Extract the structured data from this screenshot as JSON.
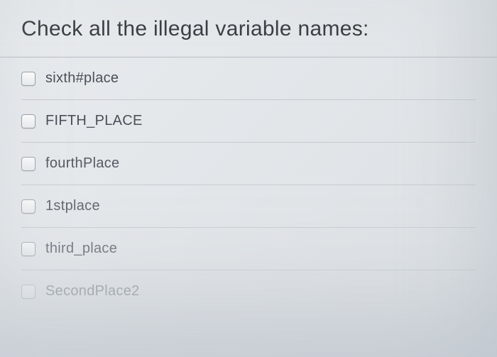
{
  "question": {
    "title": "Check all the illegal variable names:"
  },
  "options": [
    {
      "label": "sixth#place"
    },
    {
      "label": "FIFTH_PLACE"
    },
    {
      "label": "fourthPlace"
    },
    {
      "label": "1stplace"
    },
    {
      "label": "third_place"
    },
    {
      "label": "SecondPlace2"
    }
  ]
}
